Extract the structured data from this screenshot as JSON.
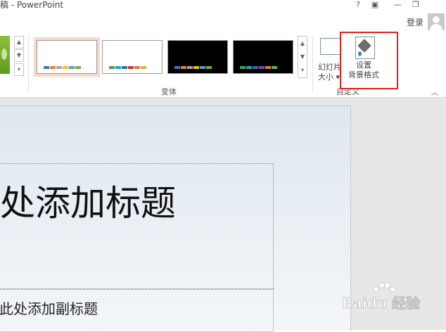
{
  "window": {
    "title": "稿 - PowerPoint",
    "help": "?",
    "ribbon_display": "▣",
    "minimize": "—",
    "restore": "❐",
    "login": "登录"
  },
  "ribbon": {
    "variants_group_label": "变体",
    "variants": [
      {
        "name": "white-1",
        "bg": "#ffffff",
        "selected": true,
        "colors": [
          "#4472c4",
          "#ed7d31",
          "#a5a5a5",
          "#ffc000",
          "#5b9bd5",
          "#70ad47"
        ]
      },
      {
        "name": "white-2",
        "bg": "#ffffff",
        "selected": false,
        "colors": [
          "#4e9a55",
          "#2b9fbf",
          "#2f6eb3",
          "#c0392b",
          "#d4832c",
          "#d8b22a"
        ]
      },
      {
        "name": "black-1",
        "bg": "#000000",
        "selected": false,
        "colors": [
          "#4472c4",
          "#ed7d31",
          "#a5a5a5",
          "#ffc000",
          "#5b9bd5",
          "#70ad47"
        ]
      },
      {
        "name": "black-2",
        "bg": "#000000",
        "selected": false,
        "colors": [
          "#4e9a55",
          "#2b9fbf",
          "#2f6eb3",
          "#8e44ad",
          "#d4832c",
          "#6ab04c"
        ]
      }
    ],
    "customize_group_label": "自定义",
    "slide_size_line1": "幻灯片",
    "slide_size_line2": "大小",
    "format_bg_line1": "设置",
    "format_bg_line2": "背景格式",
    "highlight_color": "#e0201c"
  },
  "slide": {
    "title_placeholder": "处添加标题",
    "subtitle_placeholder": "此处添加副标题"
  },
  "watermark": {
    "text": "Baidu 经验"
  }
}
